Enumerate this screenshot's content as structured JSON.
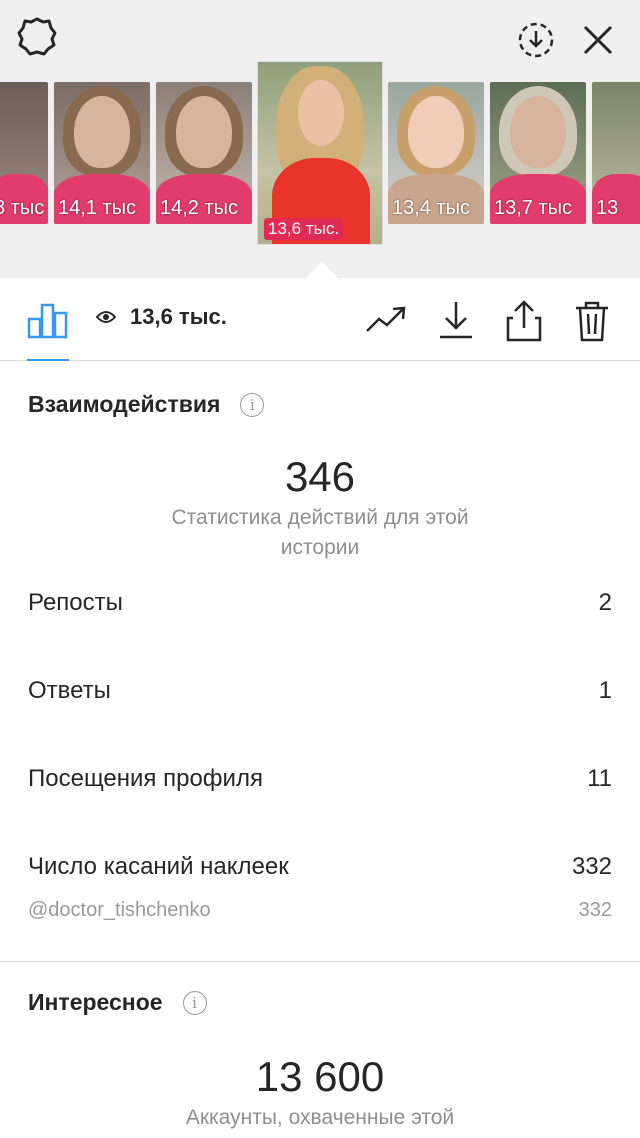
{
  "thumbnails": [
    {
      "views": "8 тыс"
    },
    {
      "views": "14,1 тыс"
    },
    {
      "views": "14,2 тыс"
    },
    {
      "views": "13,4 тыс"
    },
    {
      "views": "13,7 тыс"
    },
    {
      "views": "13"
    }
  ],
  "selected_story": {
    "views": "13,6 тыс."
  },
  "toolbar": {
    "views": "13,6 тыс."
  },
  "interactions": {
    "title": "Взаимодействия",
    "total": "346",
    "caption": "Статистика действий для этой истории",
    "rows": [
      {
        "label": "Репосты",
        "value": "2"
      },
      {
        "label": "Ответы",
        "value": "1"
      },
      {
        "label": "Посещения профиля",
        "value": "11"
      },
      {
        "label": "Число касаний наклеек",
        "value": "332"
      }
    ],
    "sticker": {
      "label": "@doctor_tishchenko",
      "value": "332"
    }
  },
  "discovery": {
    "title": "Интересное",
    "total": "13 600",
    "caption": "Аккаунты, охваченные этой"
  },
  "colors": {
    "accent": "#3897f0",
    "badge": "#e02c55"
  }
}
